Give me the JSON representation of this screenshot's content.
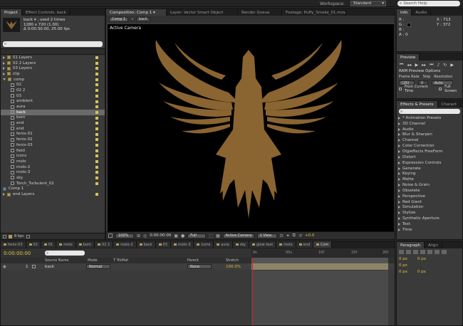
{
  "topbar": {
    "workspace_label": "Workspace:",
    "workspace_value": "Standard",
    "search_placeholder": "Search Help"
  },
  "project_panel": {
    "tab": "Project",
    "effect_controls_tab": "Effect Controls: back",
    "item_name": "back ▾ , used 2 times",
    "item_dims": "1280 x 720 (1.00)",
    "item_duration": "Δ 0:00:30:00, 25.00 fps",
    "search_placeholder": "",
    "items": [
      {
        "label": "01 Layers",
        "type": "folder"
      },
      {
        "label": "02 2 Layers",
        "type": "folder"
      },
      {
        "label": "03 Layers",
        "type": "folder"
      },
      {
        "label": "clip",
        "type": "folder"
      },
      {
        "label": "comp",
        "type": "folder-open"
      },
      {
        "label": "02",
        "type": "file"
      },
      {
        "label": "02 2",
        "type": "file"
      },
      {
        "label": "03",
        "type": "file"
      },
      {
        "label": "ambient",
        "type": "file"
      },
      {
        "label": "aura",
        "type": "file"
      },
      {
        "label": "back",
        "type": "file",
        "selected": true
      },
      {
        "label": "born",
        "type": "file"
      },
      {
        "label": "end",
        "type": "file"
      },
      {
        "label": "end",
        "type": "file"
      },
      {
        "label": "fenix-01",
        "type": "file"
      },
      {
        "label": "fenix-02",
        "type": "file"
      },
      {
        "label": "fenix-03",
        "type": "file"
      },
      {
        "label": "field",
        "type": "file"
      },
      {
        "label": "icons",
        "type": "file"
      },
      {
        "label": "molo",
        "type": "file"
      },
      {
        "label": "molo-2",
        "type": "file"
      },
      {
        "label": "molo-3",
        "type": "file"
      },
      {
        "label": "sky",
        "type": "file"
      },
      {
        "label": "Torch_Turbulent_02",
        "type": "file"
      },
      {
        "label": "Comp 1",
        "type": "comp"
      },
      {
        "label": "end Layers",
        "type": "folder"
      }
    ],
    "footer_bpc": "8 bpc"
  },
  "composition": {
    "tabs": [
      "Composition: Comp 1 ▾",
      "Layer: Vector Smart Object",
      "Render Queue",
      "Footage: Puffy_Smoke_01.mov"
    ],
    "subtabs": [
      "Comp 1",
      "back"
    ],
    "viewer_label": "Active Camera",
    "bottom": {
      "zoom": "100%",
      "timecode": "0:00:00:00",
      "resolution": "Full",
      "camera": "Active Camera",
      "views": "1 View",
      "exposure": "+0.0"
    },
    "logo_color": "#8a6431"
  },
  "info_panel": {
    "tabs": [
      "Info",
      "Audio"
    ],
    "r": "R :",
    "g": "G :",
    "b": "B :",
    "a": "A : 0",
    "x": "X : 713",
    "y": "Y : 372"
  },
  "preview_panel": {
    "tab": "Preview",
    "ram_preview": "RAM Preview Options",
    "frame_rate_label": "Frame Rate",
    "skip_label": "Skip",
    "resolution_label": "Resolution",
    "frame_rate_value": "(25)",
    "skip_value": "0",
    "resolution_value": "Auto",
    "from_current_time": "From Current Time",
    "full_screen": "Full Screen"
  },
  "effects_panel": {
    "tabs": [
      "Effects & Presets",
      "Charact"
    ],
    "search_placeholder": "",
    "items": [
      "* Animation Presets",
      "3D Channel",
      "Audio",
      "Blur & Sharpen",
      "Channel",
      "Color Correction",
      "Digieffects FreeForm",
      "Distort",
      "Expression Controls",
      "Generate",
      "Keying",
      "Matte",
      "Noise & Grain",
      "Obsolete",
      "Perspective",
      "Red Giant",
      "Simulation",
      "Stylize",
      "Synthetic Aperture",
      "Text",
      "Time"
    ]
  },
  "timeline": {
    "tabs": [
      "fenix-03",
      "02",
      "01",
      "molo",
      "born",
      "02 2",
      "molo-2",
      "back",
      "03",
      "molo-3",
      "icons",
      "aura",
      "sky",
      "glow text",
      "molo",
      "end",
      "Com"
    ],
    "timecode": "0:00:00:00",
    "columns": [
      "Source Name",
      "Mode",
      "T TrkMat",
      "Parent",
      "Stretch"
    ],
    "layer": {
      "index": "1",
      "name": "back",
      "mode": "Normal",
      "parent": "None",
      "stretch": "100.0%"
    },
    "ruler_marks": [
      "0s",
      "05s",
      "10f",
      "15f",
      "20f"
    ]
  },
  "paragraph_panel": {
    "tabs": [
      "Paragraph",
      "Align"
    ],
    "fields": [
      "0 px",
      "0 px",
      "0 px",
      "0 px",
      "0 px"
    ]
  }
}
